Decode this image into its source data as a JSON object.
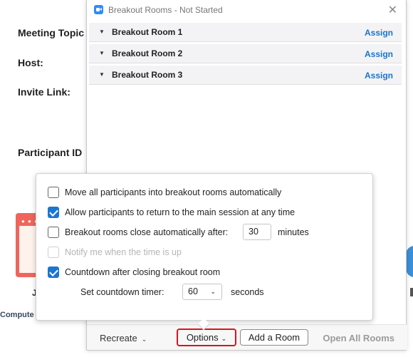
{
  "background": {
    "labels": {
      "meeting_topic": "Meeting Topic",
      "host": "Host:",
      "invite_link": "Invite Link:",
      "participant_id": "Participant ID"
    },
    "partial_j": "J",
    "partial_computer": "Compute"
  },
  "window": {
    "title": "Breakout Rooms - Not Started",
    "close_glyph": "✕",
    "rooms": [
      {
        "name": "Breakout Room 1",
        "action": "Assign"
      },
      {
        "name": "Breakout Room 2",
        "action": "Assign"
      },
      {
        "name": "Breakout Room 3",
        "action": "Assign"
      }
    ],
    "caret_glyph": "▼",
    "bottom": {
      "recreate": "Recreate",
      "options": "Options",
      "add_room": "Add a Room",
      "open_all": "Open All Rooms"
    }
  },
  "options_popup": {
    "move_all": {
      "label": "Move all participants into breakout rooms automatically",
      "checked": false
    },
    "allow_return": {
      "label": "Allow participants to return to the main session at any time",
      "checked": true
    },
    "auto_close": {
      "label": "Breakout rooms close automatically after:",
      "checked": false,
      "value": "30",
      "unit": "minutes"
    },
    "notify": {
      "label": "Notify me when the time is up",
      "checked": false,
      "disabled": true
    },
    "countdown": {
      "label": "Countdown after closing breakout room",
      "checked": true
    },
    "countdown_timer": {
      "label": "Set countdown timer:",
      "value": "60",
      "unit": "seconds"
    }
  },
  "colors": {
    "accent": "#1b76d3",
    "assign_link": "#1a73cf",
    "highlight_border": "#d9121b"
  }
}
